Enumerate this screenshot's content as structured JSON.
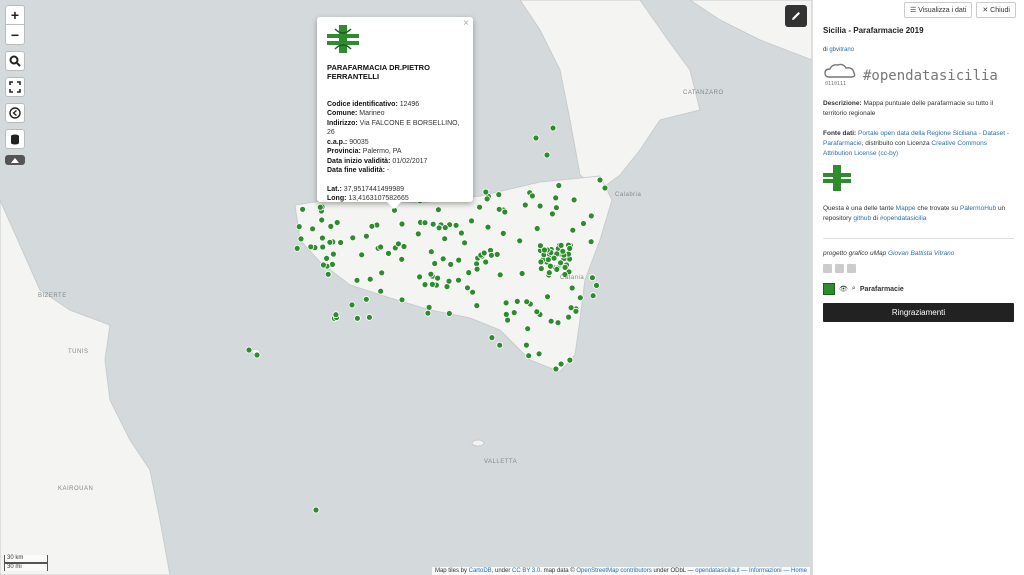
{
  "map": {
    "controls": [
      "+",
      "−"
    ],
    "places": [
      {
        "name": "CATANZARO"
      },
      {
        "name": "BIZERTE"
      },
      {
        "name": "TUNIS"
      },
      {
        "name": "KAIROUAN"
      },
      {
        "name": "VALLETTA"
      },
      {
        "name": "Calabria"
      },
      {
        "name": "Catania"
      }
    ],
    "scale": [
      "30 km",
      "30 mi"
    ],
    "attribution": {
      "prefix": "Map tiles by",
      "carto": "CartoDB",
      "under": ", under",
      "ccby": "CC BY 3.0",
      "mapdata": ". map data ©",
      "osm": "OpenStreetMap contributors",
      "odbl": "under ODbL —",
      "site": "opendatasicilia.it",
      "info": "— Informazioni",
      "home": "— Home"
    },
    "marker_color": "#2e8b2e"
  },
  "popup": {
    "title": "PARAFARMACIA DR.PIETRO FERRANTELLI",
    "fields": [
      {
        "k": "Codice identificativo:",
        "v": "12496"
      },
      {
        "k": "Comune:",
        "v": "Marineo"
      },
      {
        "k": "Indirizzo:",
        "v": "Via FALCONE E BORSELLINO, 26"
      },
      {
        "k": "c.a.p.:",
        "v": "90035"
      },
      {
        "k": "Provincia:",
        "v": "Palermo, PA"
      },
      {
        "k": "Data inizio validità:",
        "v": "01/02/2017"
      },
      {
        "k": "Data fine validità:",
        "v": "-"
      }
    ],
    "coords": [
      {
        "k": "Lat.:",
        "v": "37,9517441499989"
      },
      {
        "k": "Long:",
        "v": "13,4163107582665"
      }
    ],
    "close": "×"
  },
  "panel": {
    "btn_data": "Visualizza i dati",
    "btn_close": "Chiudi",
    "title": "Sicilia - Parafarmacie 2019",
    "by_prefix": "di",
    "by_user": "gbvitrano",
    "logo_text": "#opendatasicilia",
    "desc_label": "Descrizione:",
    "desc_text": "Mappa puntuale delle parafarmacie su tutto il territorio regionale",
    "source_label": "Fonte dati:",
    "source_link": "Portale open data della Regione Siciliana - Dataset - Parafarmacie",
    "source_mid": ", distribuito con Licenza",
    "source_license": "Creative Commons Attribution License (cc-by)",
    "hub_pre": "Questa è una delle tante",
    "hub_maps": "Mappe",
    "hub_mid": "che trovate su",
    "hub_name": "PalermoHub",
    "hub_mid2": "un repository",
    "hub_github": "github",
    "hub_di": "di",
    "hub_tag": "#opendatasicilia",
    "credit_pre": "progetto grafico uMap",
    "credit_name": "Giovan Battista Vitrano",
    "layer": "Parafarmacie",
    "thanks": "Ringraziamenti"
  }
}
